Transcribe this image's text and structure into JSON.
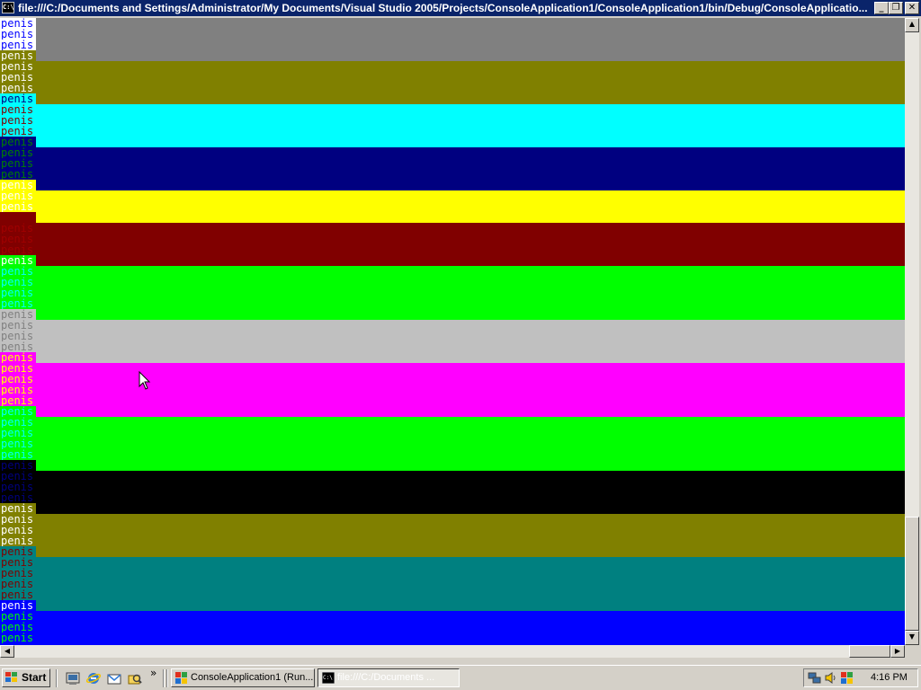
{
  "window": {
    "title": "file:///C:/Documents and Settings/Administrator/My Documents/Visual Studio 2005/Projects/ConsoleApplication1/ConsoleApplication1/bin/Debug/ConsoleApplicatio...",
    "icon_text": "C:\\",
    "minimize_glyph": "_",
    "restore_glyph": "❐",
    "close_glyph": "✕"
  },
  "console": {
    "word": "penis",
    "bands": [
      {
        "bg": "#808080",
        "lines": [
          {
            "fg": "#0000ff",
            "bg": "#ffffff"
          },
          {
            "fg": "#0000ff",
            "bg": "#ffffff"
          },
          {
            "fg": "#0000ff",
            "bg": "#ffffff"
          },
          {
            "fg": "#ffffff",
            "bg": "#808000"
          }
        ]
      },
      {
        "bg": "#808000",
        "lines": [
          {
            "fg": "#ffffff",
            "bg": "#808000"
          },
          {
            "fg": "#ffffff",
            "bg": "#808000"
          },
          {
            "fg": "#ffffff",
            "bg": "#808000"
          },
          {
            "fg": "#000080",
            "bg": "#00ffff"
          }
        ]
      },
      {
        "bg": "#00ffff",
        "lines": [
          {
            "fg": "#800000",
            "bg": "#00ffff"
          },
          {
            "fg": "#800000",
            "bg": "#00ffff"
          },
          {
            "fg": "#800000",
            "bg": "#00ffff"
          },
          {
            "fg": "#008000",
            "bg": "#000080"
          }
        ]
      },
      {
        "bg": "#000080",
        "lines": [
          {
            "fg": "#008000",
            "bg": "#000080"
          },
          {
            "fg": "#008000",
            "bg": "#000080"
          },
          {
            "fg": "#008000",
            "bg": "#000080"
          },
          {
            "fg": "#ffffff",
            "bg": "#ffff00"
          }
        ]
      },
      {
        "bg": "#ffff00",
        "lines": [
          {
            "fg": "#ffffff",
            "bg": "#ffff00"
          },
          {
            "fg": "#ffffff",
            "bg": "#ffff00"
          },
          {
            "fg": "#800000",
            "bg": "#800000"
          }
        ]
      },
      {
        "bg": "#800000",
        "lines": [
          {
            "fg": "#a00000",
            "bg": "#800000"
          },
          {
            "fg": "#a00000",
            "bg": "#800000"
          },
          {
            "fg": "#a00000",
            "bg": "#800000"
          },
          {
            "fg": "#ffffff",
            "bg": "#00ff00"
          }
        ]
      },
      {
        "bg": "#00ff00",
        "lines": [
          {
            "fg": "#00ffff",
            "bg": "#00ff00"
          },
          {
            "fg": "#00ffff",
            "bg": "#00ff00"
          },
          {
            "fg": "#00ffff",
            "bg": "#00ff00"
          },
          {
            "fg": "#00ffff",
            "bg": "#00ff00"
          },
          {
            "fg": "#808080",
            "bg": "#c0c0c0"
          }
        ]
      },
      {
        "bg": "#c0c0c0",
        "lines": [
          {
            "fg": "#808080",
            "bg": "#c0c0c0"
          },
          {
            "fg": "#808080",
            "bg": "#c0c0c0"
          },
          {
            "fg": "#808080",
            "bg": "#c0c0c0"
          },
          {
            "fg": "#ffff00",
            "bg": "#ff00ff"
          }
        ]
      },
      {
        "bg": "#ff00ff",
        "lines": [
          {
            "fg": "#ffff00",
            "bg": "#ff00ff"
          },
          {
            "fg": "#ffff00",
            "bg": "#ff00ff"
          },
          {
            "fg": "#ffff00",
            "bg": "#ff00ff"
          },
          {
            "fg": "#ffff00",
            "bg": "#ff00ff"
          },
          {
            "fg": "#00ffff",
            "bg": "#00ff00"
          }
        ]
      },
      {
        "bg": "#00ff00",
        "lines": [
          {
            "fg": "#00ffff",
            "bg": "#00ff00"
          },
          {
            "fg": "#00ffff",
            "bg": "#00ff00"
          },
          {
            "fg": "#00ffff",
            "bg": "#00ff00"
          },
          {
            "fg": "#00ffff",
            "bg": "#00ff00"
          },
          {
            "fg": "#000080",
            "bg": "#000000"
          }
        ]
      },
      {
        "bg": "#000000",
        "lines": [
          {
            "fg": "#000080",
            "bg": "#000000"
          },
          {
            "fg": "#000080",
            "bg": "#000000"
          },
          {
            "fg": "#000080",
            "bg": "#000000"
          },
          {
            "fg": "#ffffff",
            "bg": "#808000"
          }
        ]
      },
      {
        "bg": "#808000",
        "lines": [
          {
            "fg": "#ffffff",
            "bg": "#808000"
          },
          {
            "fg": "#ffffff",
            "bg": "#808000"
          },
          {
            "fg": "#ffffff",
            "bg": "#808000"
          },
          {
            "fg": "#800000",
            "bg": "#008080"
          }
        ]
      },
      {
        "bg": "#008080",
        "lines": [
          {
            "fg": "#800000",
            "bg": "#008080"
          },
          {
            "fg": "#800000",
            "bg": "#008080"
          },
          {
            "fg": "#800000",
            "bg": "#008080"
          },
          {
            "fg": "#800000",
            "bg": "#008080"
          },
          {
            "fg": "#ffffff",
            "bg": "#0000ff"
          }
        ]
      },
      {
        "bg": "#0000ff",
        "lines": [
          {
            "fg": "#00ff00",
            "bg": "#0000ff"
          },
          {
            "fg": "#00ff00",
            "bg": "#0000ff"
          },
          {
            "fg": "#00ff00",
            "bg": "#0000ff"
          }
        ]
      }
    ]
  },
  "scrollbars": {
    "up_glyph": "▲",
    "down_glyph": "▼",
    "left_glyph": "◀",
    "right_glyph": "▶"
  },
  "taskbar": {
    "start_label": "Start",
    "quick_launch_icons": [
      "show-desktop-icon",
      "internet-explorer-icon",
      "outlook-express-icon",
      "windows-explorer-icon"
    ],
    "overflow_glyph": "»",
    "tasks": [
      {
        "label": "ConsoleApplication1 (Run...",
        "icon": "visual-studio-icon",
        "active": false
      },
      {
        "label": "file:///C:/Documents ...",
        "icon": "console-icon",
        "active": true
      }
    ],
    "tray_icons": [
      "network-icon",
      "volume-icon",
      "visual-studio-tray-icon"
    ],
    "clock": "4:16 PM"
  }
}
